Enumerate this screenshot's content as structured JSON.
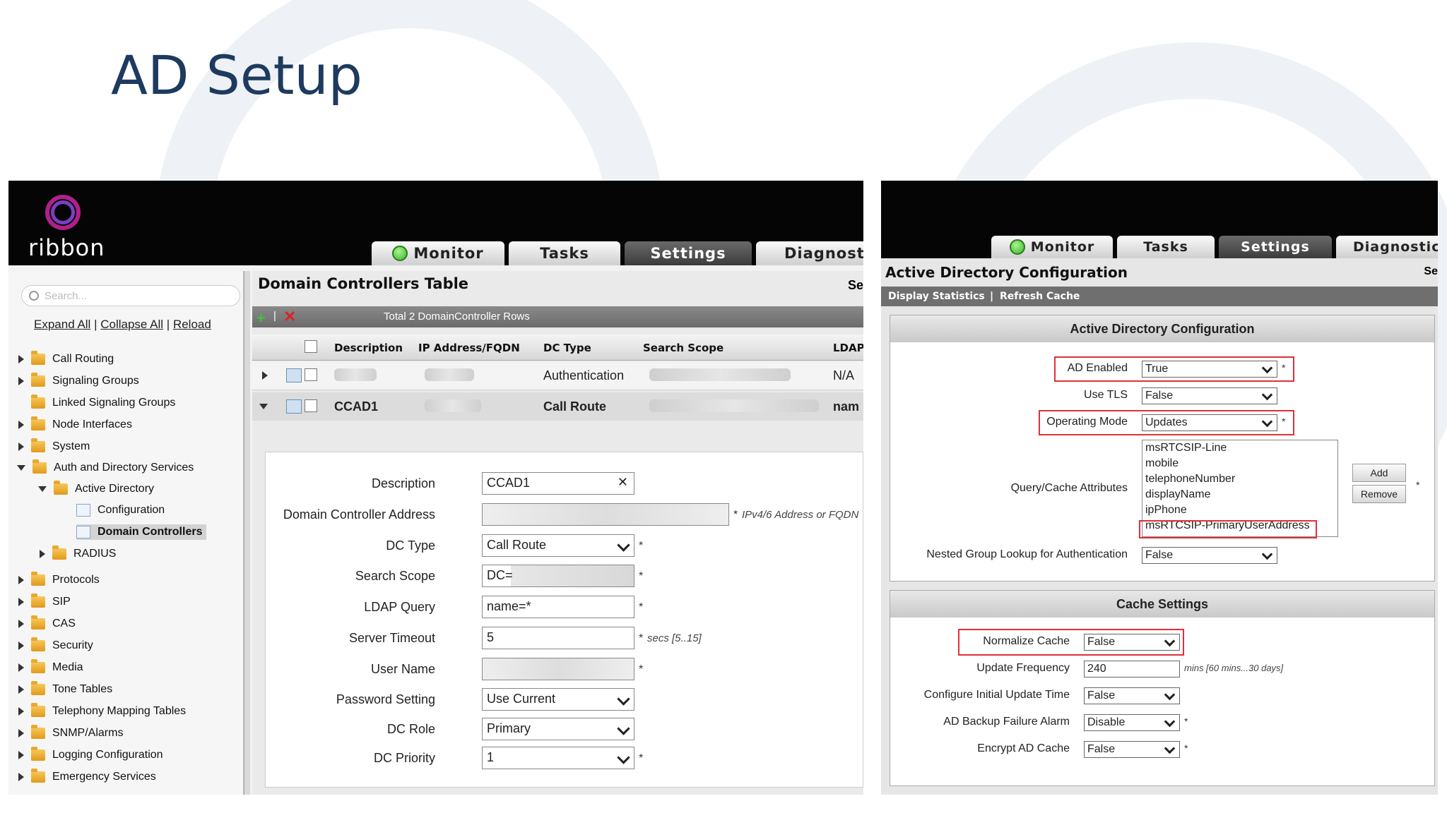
{
  "slide": {
    "title": "AD Setup"
  },
  "left": {
    "logo_text": "ribbon",
    "tabs": [
      {
        "label": "Monitor"
      },
      {
        "label": "Tasks"
      },
      {
        "label": "Settings"
      },
      {
        "label": "Diagnostic"
      }
    ],
    "search_placeholder": "Search...",
    "links": {
      "expand": "Expand All",
      "collapse": "Collapse All",
      "reload": "Reload",
      "sep": "|"
    },
    "tree": [
      "Call Routing",
      "Signaling Groups",
      "Linked Signaling Groups",
      "Node Interfaces",
      "System",
      "Auth and Directory Services",
      "Active Directory",
      "Configuration",
      "Domain Controllers",
      "RADIUS",
      "Protocols",
      "SIP",
      "CAS",
      "Security",
      "Media",
      "Tone Tables",
      "Telephony Mapping Tables",
      "SNMP/Alarms",
      "Logging Configuration",
      "Emergency Services"
    ],
    "content_title": "Domain Controllers Table",
    "content_title_right": "Se",
    "toolbar_total": "Total 2 DomainController Rows",
    "columns": [
      "Description",
      "IP Address/FQDN",
      "DC Type",
      "Search Scope",
      "LDAP"
    ],
    "rows": [
      {
        "description": "",
        "dc_type": "Authentication",
        "ldap": "N/A"
      },
      {
        "description": "CCAD1",
        "dc_type": "Call Route",
        "ldap": "nam"
      }
    ],
    "form": {
      "description_label": "Description",
      "description_value": "CCAD1",
      "dc_address_label": "Domain Controller Address",
      "dc_address_hint": "IPv4/6 Address or FQDN",
      "dc_type_label": "DC Type",
      "dc_type_value": "Call Route",
      "search_scope_label": "Search Scope",
      "search_scope_value": "DC=",
      "ldap_query_label": "LDAP Query",
      "ldap_query_value": "name=*",
      "server_timeout_label": "Server Timeout",
      "server_timeout_value": "5",
      "server_timeout_hint": "secs [5..15]",
      "user_name_label": "User Name",
      "password_setting_label": "Password Setting",
      "password_setting_value": "Use Current",
      "dc_role_label": "DC Role",
      "dc_role_value": "Primary",
      "dc_priority_label": "DC Priority",
      "dc_priority_value": "1",
      "required_mark": "*"
    }
  },
  "right": {
    "tabs": [
      {
        "label": "Monitor"
      },
      {
        "label": "Tasks"
      },
      {
        "label": "Settings"
      },
      {
        "label": "Diagnostics"
      }
    ],
    "title": "Active Directory Configuration",
    "title_right": "Se",
    "toolbar": {
      "display_statistics": "Display Statistics",
      "sep": "|",
      "refresh_cache": "Refresh Cache"
    },
    "ad_panel": {
      "heading": "Active Directory Configuration",
      "ad_enabled_label": "AD Enabled",
      "ad_enabled_value": "True",
      "use_tls_label": "Use TLS",
      "use_tls_value": "False",
      "operating_mode_label": "Operating Mode",
      "operating_mode_value": "Updates",
      "query_cache_label": "Query/Cache Attributes",
      "attributes": [
        "msRTCSIP-Line",
        "mobile",
        "telephoneNumber",
        "displayName",
        "ipPhone",
        "msRTCSIP-PrimaryUserAddress"
      ],
      "add_button": "Add",
      "remove_button": "Remove",
      "nested_label": "Nested Group Lookup for Authentication",
      "nested_value": "False",
      "required_mark": "*"
    },
    "cache_panel": {
      "heading": "Cache Settings",
      "normalize_label": "Normalize Cache",
      "normalize_value": "False",
      "update_freq_label": "Update Frequency",
      "update_freq_value": "240",
      "update_freq_hint": "mins [60 mins...30 days]",
      "initial_update_label": "Configure Initial Update Time",
      "initial_update_value": "False",
      "backup_alarm_label": "AD Backup Failure Alarm",
      "backup_alarm_value": "Disable",
      "encrypt_label": "Encrypt AD Cache",
      "encrypt_value": "False",
      "required_mark": "*"
    }
  },
  "colors": {
    "title": "#1e3a5f",
    "highlight": "#e0303a",
    "topbar": "#050505",
    "logo": "#b0208a"
  }
}
